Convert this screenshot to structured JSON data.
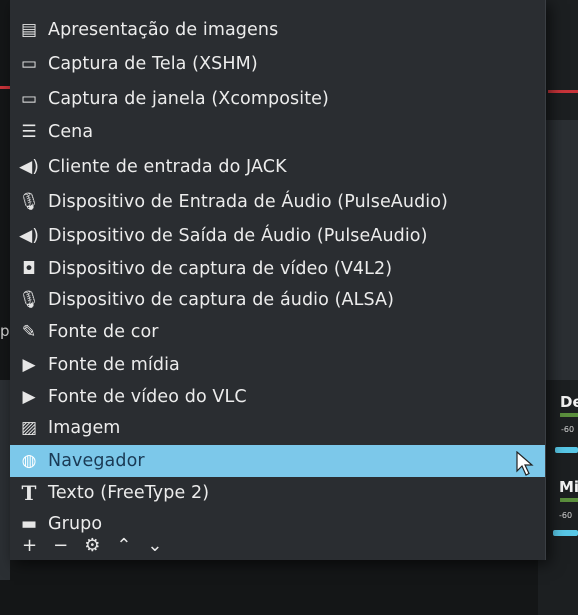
{
  "menu": {
    "items": [
      {
        "label": "Apresentação de imagens",
        "icon": "slideshow-icon",
        "glyph": "▤"
      },
      {
        "label": "Captura de Tela (XSHM)",
        "icon": "monitor-icon",
        "glyph": "🖵"
      },
      {
        "label": "Captura de janela (Xcomposite)",
        "icon": "window-icon",
        "glyph": "▭"
      },
      {
        "label": "Cena",
        "icon": "list-icon",
        "glyph": "☰"
      },
      {
        "label": "Cliente de entrada do JACK",
        "icon": "speaker-icon",
        "glyph": "🔊"
      },
      {
        "label": "Dispositivo de Entrada de Áudio (PulseAudio)",
        "icon": "microphone-icon",
        "glyph": "🎙"
      },
      {
        "label": "Dispositivo de Saída de Áudio (PulseAudio)",
        "icon": "speaker-icon",
        "glyph": "🔊"
      },
      {
        "label": "Dispositivo de captura de vídeo (V4L2)",
        "icon": "camera-icon",
        "glyph": "📷"
      },
      {
        "label": "Dispositivo de captura de áudio (ALSA)",
        "icon": "microphone-icon",
        "glyph": "🎙"
      },
      {
        "label": "Fonte de cor",
        "icon": "brush-icon",
        "glyph": "🖌"
      },
      {
        "label": "Fonte de mídia",
        "icon": "play-icon",
        "glyph": "▶"
      },
      {
        "label": "Fonte de vídeo do VLC",
        "icon": "play-icon",
        "glyph": "▶"
      },
      {
        "label": "Imagem",
        "icon": "image-icon",
        "glyph": "🖼"
      },
      {
        "label": "Navegador",
        "icon": "globe-icon",
        "glyph": "🌐",
        "highlighted": true
      },
      {
        "label": "Texto (FreeType 2)",
        "icon": "text-icon",
        "glyph": "T"
      },
      {
        "label": "Grupo",
        "icon": "folder-icon",
        "glyph": "▬"
      }
    ]
  },
  "background": {
    "left_peek_text": "pri",
    "right_label_1": "De",
    "right_label_2": "Mic",
    "meter_tick_1": "-60",
    "meter_tick_2": "-60"
  },
  "toolbar": {
    "add": "+",
    "remove": "−",
    "settings": "⚙",
    "up": "⌃",
    "down": "⌄"
  },
  "colors": {
    "menu_bg": "#2a2d31",
    "highlight": "#7cc8ea",
    "accent_red": "#c9343a",
    "accent_cyan": "#58c7e6"
  }
}
